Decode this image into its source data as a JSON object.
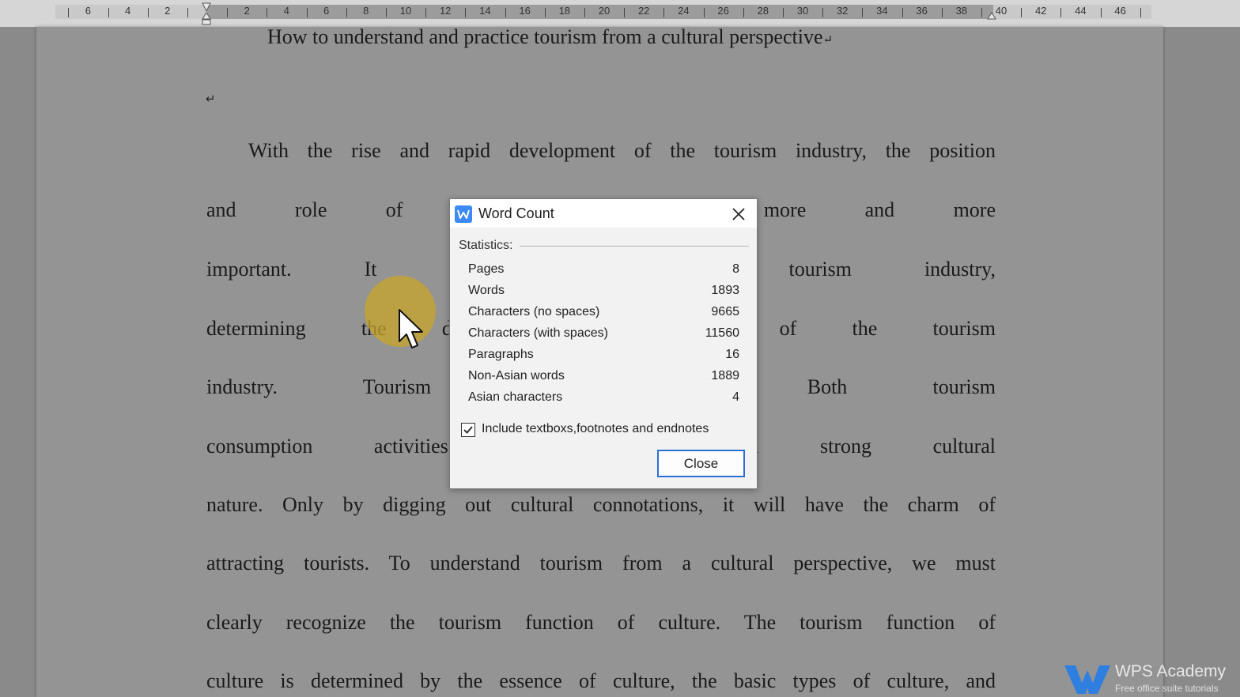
{
  "ruler": {
    "labels": [
      "6",
      "4",
      "2",
      "2",
      "4",
      "6",
      "8",
      "10",
      "12",
      "14",
      "16",
      "18",
      "20",
      "22",
      "24",
      "26",
      "28",
      "30",
      "32",
      "34",
      "36",
      "38",
      "40",
      "42",
      "44",
      "46"
    ]
  },
  "document": {
    "title": "How to understand and practice tourism from a cultural perspective",
    "title_mark": "↵",
    "empty_para_mark": "↵",
    "lines": [
      "With the rise and rapid development of the tourism industry, the position",
      "and role of culture in                                          oming more and more",
      "important. It is becomi                                         entire tourism industry,",
      "determining the de elop                                          r failure of the tourism",
      "industry. Tourism activ                                          activities. Both tourism",
      "consumption activities a                                         s have a strong cultural",
      "nature. Only by digging out cultural connotations, it will have the charm of",
      "attracting tourists. To understand tourism from a cultural perspective, we must",
      "clearly recognize the tourism function of culture. The tourism function of",
      "culture is determined by the essence of culture, the basic types of culture, and"
    ]
  },
  "dialog": {
    "title": "Word Count",
    "group_label": "Statistics:",
    "stats": [
      {
        "label": "Pages",
        "value": "8"
      },
      {
        "label": "Words",
        "value": "1893"
      },
      {
        "label": "Characters (no spaces)",
        "value": "9665"
      },
      {
        "label": "Characters (with spaces)",
        "value": "11560"
      },
      {
        "label": "Paragraphs",
        "value": "16"
      },
      {
        "label": "Non-Asian words",
        "value": "1889"
      },
      {
        "label": "Asian characters",
        "value": "4"
      }
    ],
    "include_checkbox": {
      "label": "Include textboxs,footnotes and endnotes",
      "checked": true
    },
    "close_label": "Close"
  },
  "watermark": {
    "name": "WPS Academy",
    "tagline": "Free office suite tutorials"
  },
  "colors": {
    "accent": "#2b6fd6",
    "app_icon": "#3d8af7",
    "highlight": "#c8a528",
    "watermark_logo": "#2f7fe0"
  }
}
